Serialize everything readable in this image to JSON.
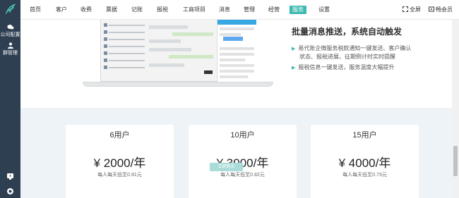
{
  "sidebar": {
    "items": [
      {
        "label": "公司配置",
        "icon": "chat-bubble-icon"
      },
      {
        "label": "群管理",
        "icon": "person-icon"
      }
    ]
  },
  "nav": {
    "items": [
      "首页",
      "客户",
      "收费",
      "票据",
      "记账",
      "报税",
      "工商项目",
      "消息",
      "管理",
      "经营",
      "服务",
      "设置"
    ],
    "active": "服务",
    "fullscreen_label": "全屏",
    "account_label": "畅会员"
  },
  "hero": {
    "title": "批量消息推送，系统自动触发",
    "bullets": [
      "易代账企微服务税款通知一键发送、客户确认",
      "状态、报税进展、征期倒计时实时提醒",
      "报税信息一键发送，服务温度大幅提升"
    ]
  },
  "plans": [
    {
      "users": "6用户",
      "price": "¥ 2000/年",
      "per_day": "每人每天低至0.91元"
    },
    {
      "users": "10用户",
      "price": "¥ 3000/年",
      "per_day": "每人每天低至0.82元"
    },
    {
      "users": "15用户",
      "price": "¥ 4000/年",
      "per_day": "每人每天低至0.73元"
    }
  ],
  "buy_button": "立即购买",
  "colors": {
    "sidebar": "#2e3f52",
    "accent": "#3ebab1",
    "light_bg": "#edf3f7"
  }
}
